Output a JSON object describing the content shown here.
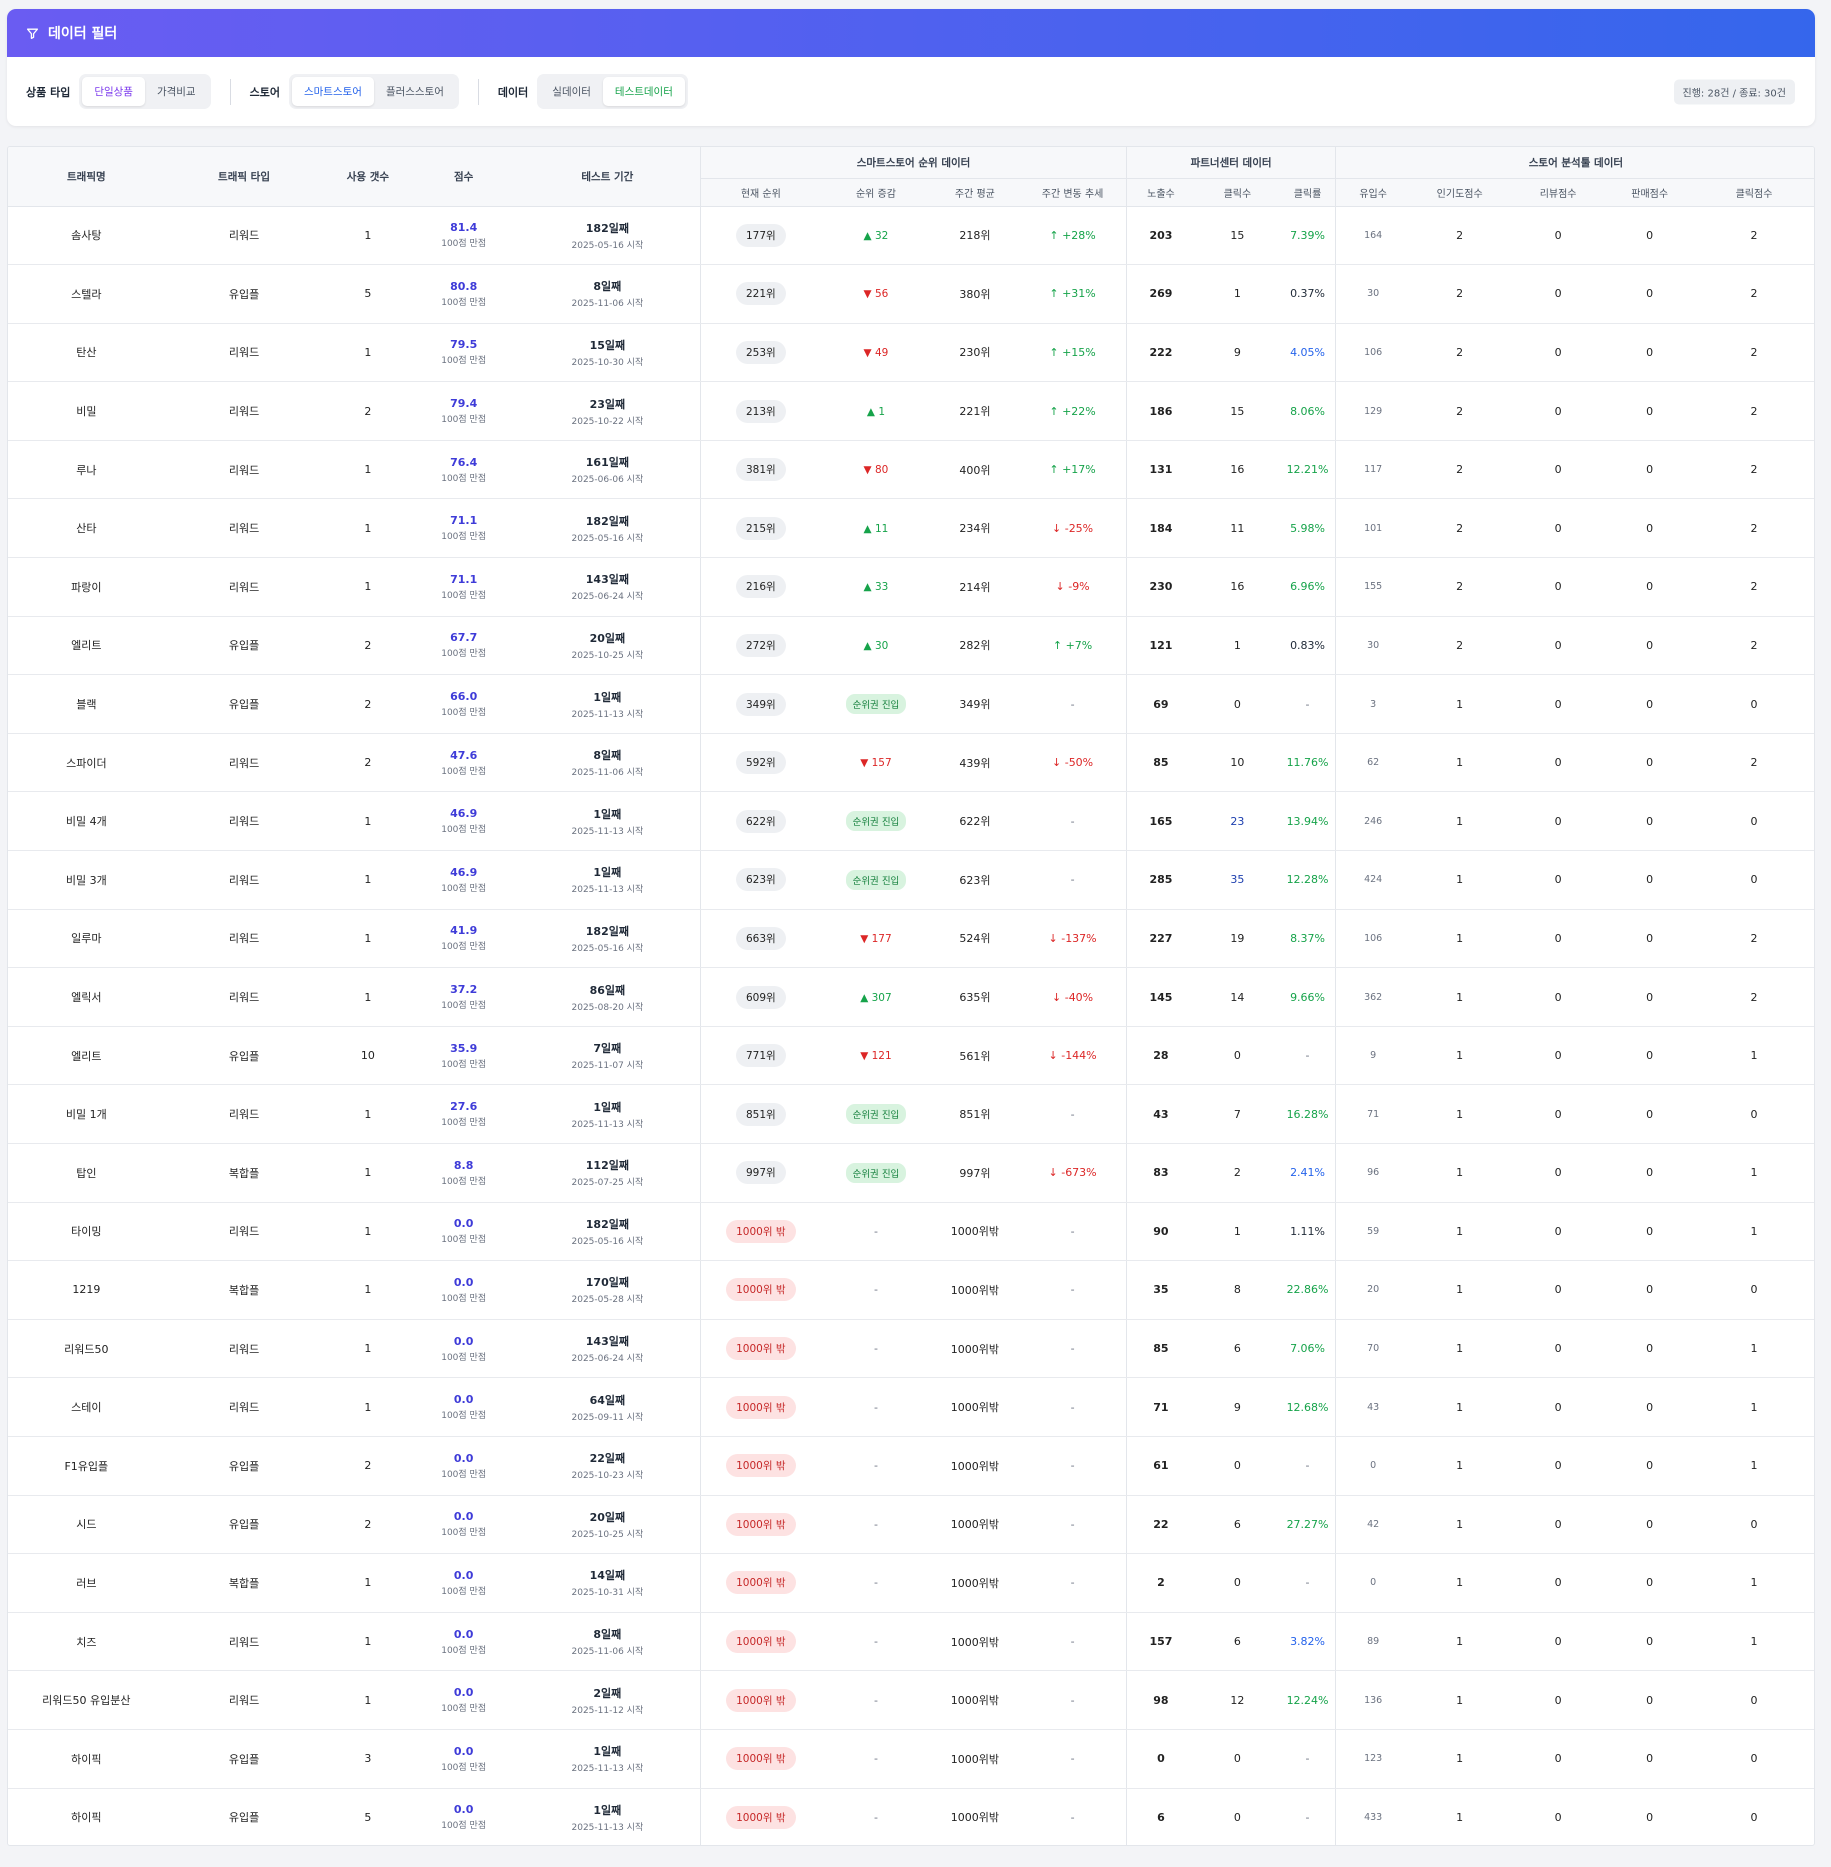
{
  "filter": {
    "title": "데이터 필터",
    "groups": [
      {
        "label": "상품 타입",
        "options": [
          "단일상품",
          "가격비교"
        ],
        "active": 0,
        "active_color": "#7c3aed"
      },
      {
        "label": "스토어",
        "options": [
          "스마트스토어",
          "플러스스토어"
        ],
        "active": 0,
        "active_color": "#2563eb"
      },
      {
        "label": "데이터",
        "options": [
          "실데이터",
          "테스트데이터"
        ],
        "active": 1,
        "active_color": "#16a34a"
      }
    ],
    "summary": "진행: 28건 / 종료: 30건"
  },
  "table": {
    "columns": [
      "트래픽명",
      "트래픽 타입",
      "사용 갯수",
      "점수",
      "테스트 기간"
    ],
    "groups": [
      "스마트스토어 순위 데이터",
      "파트너센터 데이터",
      "스토어 분석툴 데이터"
    ],
    "subcolumns": {
      "smartstore": [
        "현재 순위",
        "순위 증감",
        "주간 평균",
        "주간 변동 추세"
      ],
      "partner": [
        "노출수",
        "클릭수",
        "클릭률"
      ],
      "analysis": [
        "유입수",
        "인기도점수",
        "리뷰점수",
        "판매점수",
        "클릭점수"
      ]
    },
    "rows": [
      {
        "name": "솜사탕",
        "type": "리워드",
        "count": "1",
        "score": "81.4",
        "score_sub": "100점 만점",
        "period": "182일째",
        "start": "2025-05-16 시작",
        "rank": "177위",
        "rank_out": false,
        "chg": "32",
        "chg_dir": "up",
        "avg": "218위",
        "trend": "+28%",
        "trend_dir": "up",
        "imp": "203",
        "clicks": "15",
        "clicks_hl": false,
        "ctr": "7.39%",
        "ctr_color": "green",
        "inflow": "164",
        "pop": "2",
        "review": "0",
        "sales": "0",
        "click_score": "2"
      },
      {
        "name": "스텔라",
        "type": "유입플",
        "count": "5",
        "score": "80.8",
        "score_sub": "100점 만점",
        "period": "8일째",
        "start": "2025-11-06 시작",
        "rank": "221위",
        "rank_out": false,
        "chg": "56",
        "chg_dir": "down",
        "avg": "380위",
        "trend": "+31%",
        "trend_dir": "up",
        "imp": "269",
        "clicks": "1",
        "clicks_hl": false,
        "ctr": "0.37%",
        "ctr_color": "dark",
        "inflow": "30",
        "pop": "2",
        "review": "0",
        "sales": "0",
        "click_score": "2"
      },
      {
        "name": "탄산",
        "type": "리워드",
        "count": "1",
        "score": "79.5",
        "score_sub": "100점 만점",
        "period": "15일째",
        "start": "2025-10-30 시작",
        "rank": "253위",
        "rank_out": false,
        "chg": "49",
        "chg_dir": "down",
        "avg": "230위",
        "trend": "+15%",
        "trend_dir": "up",
        "imp": "222",
        "clicks": "9",
        "clicks_hl": false,
        "ctr": "4.05%",
        "ctr_color": "blue",
        "inflow": "106",
        "pop": "2",
        "review": "0",
        "sales": "0",
        "click_score": "2"
      },
      {
        "name": "비밀",
        "type": "리워드",
        "count": "2",
        "score": "79.4",
        "score_sub": "100점 만점",
        "period": "23일째",
        "start": "2025-10-22 시작",
        "rank": "213위",
        "rank_out": false,
        "chg": "1",
        "chg_dir": "up",
        "avg": "221위",
        "trend": "+22%",
        "trend_dir": "up",
        "imp": "186",
        "clicks": "15",
        "clicks_hl": false,
        "ctr": "8.06%",
        "ctr_color": "green",
        "inflow": "129",
        "pop": "2",
        "review": "0",
        "sales": "0",
        "click_score": "2"
      },
      {
        "name": "루나",
        "type": "리워드",
        "count": "1",
        "score": "76.4",
        "score_sub": "100점 만점",
        "period": "161일째",
        "start": "2025-06-06 시작",
        "rank": "381위",
        "rank_out": false,
        "chg": "80",
        "chg_dir": "down",
        "avg": "400위",
        "trend": "+17%",
        "trend_dir": "up",
        "imp": "131",
        "clicks": "16",
        "clicks_hl": false,
        "ctr": "12.21%",
        "ctr_color": "green",
        "inflow": "117",
        "pop": "2",
        "review": "0",
        "sales": "0",
        "click_score": "2"
      },
      {
        "name": "산타",
        "type": "리워드",
        "count": "1",
        "score": "71.1",
        "score_sub": "100점 만점",
        "period": "182일째",
        "start": "2025-05-16 시작",
        "rank": "215위",
        "rank_out": false,
        "chg": "11",
        "chg_dir": "up",
        "avg": "234위",
        "trend": "-25%",
        "trend_dir": "down",
        "imp": "184",
        "clicks": "11",
        "clicks_hl": false,
        "ctr": "5.98%",
        "ctr_color": "green",
        "inflow": "101",
        "pop": "2",
        "review": "0",
        "sales": "0",
        "click_score": "2"
      },
      {
        "name": "파랑이",
        "type": "리워드",
        "count": "1",
        "score": "71.1",
        "score_sub": "100점 만점",
        "period": "143일째",
        "start": "2025-06-24 시작",
        "rank": "216위",
        "rank_out": false,
        "chg": "33",
        "chg_dir": "up",
        "avg": "214위",
        "trend": "-9%",
        "trend_dir": "down",
        "imp": "230",
        "clicks": "16",
        "clicks_hl": false,
        "ctr": "6.96%",
        "ctr_color": "green",
        "inflow": "155",
        "pop": "2",
        "review": "0",
        "sales": "0",
        "click_score": "2"
      },
      {
        "name": "엘리트",
        "type": "유입플",
        "count": "2",
        "score": "67.7",
        "score_sub": "100점 만점",
        "period": "20일째",
        "start": "2025-10-25 시작",
        "rank": "272위",
        "rank_out": false,
        "chg": "30",
        "chg_dir": "up",
        "avg": "282위",
        "trend": "+7%",
        "trend_dir": "up",
        "imp": "121",
        "clicks": "1",
        "clicks_hl": false,
        "ctr": "0.83%",
        "ctr_color": "dark",
        "inflow": "30",
        "pop": "2",
        "review": "0",
        "sales": "0",
        "click_score": "2"
      },
      {
        "name": "블랙",
        "type": "유입플",
        "count": "2",
        "score": "66.0",
        "score_sub": "100점 만점",
        "period": "1일째",
        "start": "2025-11-13 시작",
        "rank": "349위",
        "rank_out": false,
        "chg": "순위권 진입",
        "chg_dir": "new",
        "avg": "349위",
        "trend": "-",
        "trend_dir": "none",
        "imp": "69",
        "clicks": "0",
        "clicks_hl": false,
        "ctr": "-",
        "ctr_color": "dash",
        "inflow": "3",
        "pop": "1",
        "review": "0",
        "sales": "0",
        "click_score": "0"
      },
      {
        "name": "스파이더",
        "type": "리워드",
        "count": "2",
        "score": "47.6",
        "score_sub": "100점 만점",
        "period": "8일째",
        "start": "2025-11-06 시작",
        "rank": "592위",
        "rank_out": false,
        "chg": "157",
        "chg_dir": "down",
        "avg": "439위",
        "trend": "-50%",
        "trend_dir": "down",
        "imp": "85",
        "clicks": "10",
        "clicks_hl": false,
        "ctr": "11.76%",
        "ctr_color": "green",
        "inflow": "62",
        "pop": "1",
        "review": "0",
        "sales": "0",
        "click_score": "2"
      },
      {
        "name": "비밀 4개",
        "type": "리워드",
        "count": "1",
        "score": "46.9",
        "score_sub": "100점 만점",
        "period": "1일째",
        "start": "2025-11-13 시작",
        "rank": "622위",
        "rank_out": false,
        "chg": "순위권 진입",
        "chg_dir": "new",
        "avg": "622위",
        "trend": "-",
        "trend_dir": "none",
        "imp": "165",
        "clicks": "23",
        "clicks_hl": true,
        "ctr": "13.94%",
        "ctr_color": "green",
        "inflow": "246",
        "pop": "1",
        "review": "0",
        "sales": "0",
        "click_score": "0"
      },
      {
        "name": "비밀 3개",
        "type": "리워드",
        "count": "1",
        "score": "46.9",
        "score_sub": "100점 만점",
        "period": "1일째",
        "start": "2025-11-13 시작",
        "rank": "623위",
        "rank_out": false,
        "chg": "순위권 진입",
        "chg_dir": "new",
        "avg": "623위",
        "trend": "-",
        "trend_dir": "none",
        "imp": "285",
        "clicks": "35",
        "clicks_hl": true,
        "ctr": "12.28%",
        "ctr_color": "green",
        "inflow": "424",
        "pop": "1",
        "review": "0",
        "sales": "0",
        "click_score": "0"
      },
      {
        "name": "일루마",
        "type": "리워드",
        "count": "1",
        "score": "41.9",
        "score_sub": "100점 만점",
        "period": "182일째",
        "start": "2025-05-16 시작",
        "rank": "663위",
        "rank_out": false,
        "chg": "177",
        "chg_dir": "down",
        "avg": "524위",
        "trend": "-137%",
        "trend_dir": "down",
        "imp": "227",
        "clicks": "19",
        "clicks_hl": false,
        "ctr": "8.37%",
        "ctr_color": "green",
        "inflow": "106",
        "pop": "1",
        "review": "0",
        "sales": "0",
        "click_score": "2"
      },
      {
        "name": "엘릭서",
        "type": "리워드",
        "count": "1",
        "score": "37.2",
        "score_sub": "100점 만점",
        "period": "86일째",
        "start": "2025-08-20 시작",
        "rank": "609위",
        "rank_out": false,
        "chg": "307",
        "chg_dir": "up",
        "avg": "635위",
        "trend": "-40%",
        "trend_dir": "down",
        "imp": "145",
        "clicks": "14",
        "clicks_hl": false,
        "ctr": "9.66%",
        "ctr_color": "green",
        "inflow": "362",
        "pop": "1",
        "review": "0",
        "sales": "0",
        "click_score": "2"
      },
      {
        "name": "엘리트",
        "type": "유입플",
        "count": "10",
        "score": "35.9",
        "score_sub": "100점 만점",
        "period": "7일째",
        "start": "2025-11-07 시작",
        "rank": "771위",
        "rank_out": false,
        "chg": "121",
        "chg_dir": "down",
        "avg": "561위",
        "trend": "-144%",
        "trend_dir": "down",
        "imp": "28",
        "clicks": "0",
        "clicks_hl": false,
        "ctr": "-",
        "ctr_color": "dash",
        "inflow": "9",
        "pop": "1",
        "review": "0",
        "sales": "0",
        "click_score": "1"
      },
      {
        "name": "비밀 1개",
        "type": "리워드",
        "count": "1",
        "score": "27.6",
        "score_sub": "100점 만점",
        "period": "1일째",
        "start": "2025-11-13 시작",
        "rank": "851위",
        "rank_out": false,
        "chg": "순위권 진입",
        "chg_dir": "new",
        "avg": "851위",
        "trend": "-",
        "trend_dir": "none",
        "imp": "43",
        "clicks": "7",
        "clicks_hl": false,
        "ctr": "16.28%",
        "ctr_color": "green",
        "inflow": "71",
        "pop": "1",
        "review": "0",
        "sales": "0",
        "click_score": "0"
      },
      {
        "name": "탑인",
        "type": "복합플",
        "count": "1",
        "score": "8.8",
        "score_sub": "100점 만점",
        "period": "112일째",
        "start": "2025-07-25 시작",
        "rank": "997위",
        "rank_out": false,
        "chg": "순위권 진입",
        "chg_dir": "new",
        "avg": "997위",
        "trend": "-673%",
        "trend_dir": "down",
        "imp": "83",
        "clicks": "2",
        "clicks_hl": false,
        "ctr": "2.41%",
        "ctr_color": "blue",
        "inflow": "96",
        "pop": "1",
        "review": "0",
        "sales": "0",
        "click_score": "1"
      },
      {
        "name": "타이밍",
        "type": "리워드",
        "count": "1",
        "score": "0.0",
        "score_sub": "100점 만점",
        "period": "182일째",
        "start": "2025-05-16 시작",
        "rank": "1000위 밖",
        "rank_out": true,
        "chg": "-",
        "chg_dir": "none",
        "avg": "1000위밖",
        "trend": "-",
        "trend_dir": "none",
        "imp": "90",
        "clicks": "1",
        "clicks_hl": false,
        "ctr": "1.11%",
        "ctr_color": "dark",
        "inflow": "59",
        "pop": "1",
        "review": "0",
        "sales": "0",
        "click_score": "1"
      },
      {
        "name": "1219",
        "type": "복합플",
        "count": "1",
        "score": "0.0",
        "score_sub": "100점 만점",
        "period": "170일째",
        "start": "2025-05-28 시작",
        "rank": "1000위 밖",
        "rank_out": true,
        "chg": "-",
        "chg_dir": "none",
        "avg": "1000위밖",
        "trend": "-",
        "trend_dir": "none",
        "imp": "35",
        "clicks": "8",
        "clicks_hl": false,
        "ctr": "22.86%",
        "ctr_color": "green",
        "inflow": "20",
        "pop": "1",
        "review": "0",
        "sales": "0",
        "click_score": "0"
      },
      {
        "name": "리워드50",
        "type": "리워드",
        "count": "1",
        "score": "0.0",
        "score_sub": "100점 만점",
        "period": "143일째",
        "start": "2025-06-24 시작",
        "rank": "1000위 밖",
        "rank_out": true,
        "chg": "-",
        "chg_dir": "none",
        "avg": "1000위밖",
        "trend": "-",
        "trend_dir": "none",
        "imp": "85",
        "clicks": "6",
        "clicks_hl": false,
        "ctr": "7.06%",
        "ctr_color": "green",
        "inflow": "70",
        "pop": "1",
        "review": "0",
        "sales": "0",
        "click_score": "1"
      },
      {
        "name": "스테이",
        "type": "리워드",
        "count": "1",
        "score": "0.0",
        "score_sub": "100점 만점",
        "period": "64일째",
        "start": "2025-09-11 시작",
        "rank": "1000위 밖",
        "rank_out": true,
        "chg": "-",
        "chg_dir": "none",
        "avg": "1000위밖",
        "trend": "-",
        "trend_dir": "none",
        "imp": "71",
        "clicks": "9",
        "clicks_hl": false,
        "ctr": "12.68%",
        "ctr_color": "green",
        "inflow": "43",
        "pop": "1",
        "review": "0",
        "sales": "0",
        "click_score": "1"
      },
      {
        "name": "F1유입플",
        "type": "유입플",
        "count": "2",
        "score": "0.0",
        "score_sub": "100점 만점",
        "period": "22일째",
        "start": "2025-10-23 시작",
        "rank": "1000위 밖",
        "rank_out": true,
        "chg": "-",
        "chg_dir": "none",
        "avg": "1000위밖",
        "trend": "-",
        "trend_dir": "none",
        "imp": "61",
        "clicks": "0",
        "clicks_hl": false,
        "ctr": "-",
        "ctr_color": "dash",
        "inflow": "0",
        "pop": "1",
        "review": "0",
        "sales": "0",
        "click_score": "1"
      },
      {
        "name": "시드",
        "type": "유입플",
        "count": "2",
        "score": "0.0",
        "score_sub": "100점 만점",
        "period": "20일째",
        "start": "2025-10-25 시작",
        "rank": "1000위 밖",
        "rank_out": true,
        "chg": "-",
        "chg_dir": "none",
        "avg": "1000위밖",
        "trend": "-",
        "trend_dir": "none",
        "imp": "22",
        "clicks": "6",
        "clicks_hl": false,
        "ctr": "27.27%",
        "ctr_color": "green",
        "inflow": "42",
        "pop": "1",
        "review": "0",
        "sales": "0",
        "click_score": "0"
      },
      {
        "name": "러브",
        "type": "복합플",
        "count": "1",
        "score": "0.0",
        "score_sub": "100점 만점",
        "period": "14일째",
        "start": "2025-10-31 시작",
        "rank": "1000위 밖",
        "rank_out": true,
        "chg": "-",
        "chg_dir": "none",
        "avg": "1000위밖",
        "trend": "-",
        "trend_dir": "none",
        "imp": "2",
        "clicks": "0",
        "clicks_hl": false,
        "ctr": "-",
        "ctr_color": "dash",
        "inflow": "0",
        "pop": "1",
        "review": "0",
        "sales": "0",
        "click_score": "1"
      },
      {
        "name": "치즈",
        "type": "리워드",
        "count": "1",
        "score": "0.0",
        "score_sub": "100점 만점",
        "period": "8일째",
        "start": "2025-11-06 시작",
        "rank": "1000위 밖",
        "rank_out": true,
        "chg": "-",
        "chg_dir": "none",
        "avg": "1000위밖",
        "trend": "-",
        "trend_dir": "none",
        "imp": "157",
        "clicks": "6",
        "clicks_hl": false,
        "ctr": "3.82%",
        "ctr_color": "blue",
        "inflow": "89",
        "pop": "1",
        "review": "0",
        "sales": "0",
        "click_score": "1"
      },
      {
        "name": "리워드50 유입분산",
        "type": "리워드",
        "count": "1",
        "score": "0.0",
        "score_sub": "100점 만점",
        "period": "2일째",
        "start": "2025-11-12 시작",
        "rank": "1000위 밖",
        "rank_out": true,
        "chg": "-",
        "chg_dir": "none",
        "avg": "1000위밖",
        "trend": "-",
        "trend_dir": "none",
        "imp": "98",
        "clicks": "12",
        "clicks_hl": false,
        "ctr": "12.24%",
        "ctr_color": "green",
        "inflow": "136",
        "pop": "1",
        "review": "0",
        "sales": "0",
        "click_score": "0"
      },
      {
        "name": "하이픽",
        "type": "유입플",
        "count": "3",
        "score": "0.0",
        "score_sub": "100점 만점",
        "period": "1일째",
        "start": "2025-11-13 시작",
        "rank": "1000위 밖",
        "rank_out": true,
        "chg": "-",
        "chg_dir": "none",
        "avg": "1000위밖",
        "trend": "-",
        "trend_dir": "none",
        "imp": "0",
        "clicks": "0",
        "clicks_hl": false,
        "ctr": "-",
        "ctr_color": "dash",
        "inflow": "123",
        "pop": "1",
        "review": "0",
        "sales": "0",
        "click_score": "0"
      },
      {
        "name": "하이픽",
        "type": "유입플",
        "count": "5",
        "score": "0.0",
        "score_sub": "100점 만점",
        "period": "1일째",
        "start": "2025-11-13 시작",
        "rank": "1000위 밖",
        "rank_out": true,
        "chg": "-",
        "chg_dir": "none",
        "avg": "1000위밖",
        "trend": "-",
        "trend_dir": "none",
        "imp": "6",
        "clicks": "0",
        "clicks_hl": false,
        "ctr": "-",
        "ctr_color": "dash",
        "inflow": "433",
        "pop": "1",
        "review": "0",
        "sales": "0",
        "click_score": "0"
      }
    ]
  }
}
